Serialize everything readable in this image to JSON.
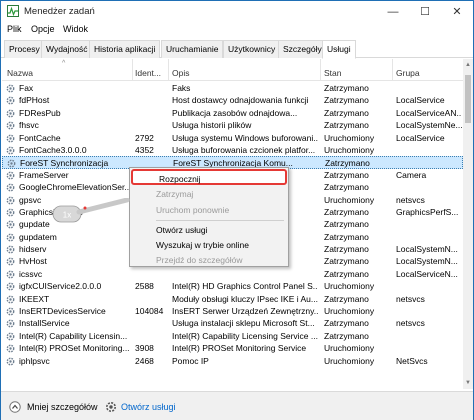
{
  "window": {
    "title": "Menedżer zadań",
    "minimize": "—",
    "maximize": "☐",
    "close": "✕"
  },
  "menubar": [
    "Plik",
    "Opcje",
    "Widok"
  ],
  "tabs": [
    "Procesy",
    "Wydajność",
    "Historia aplikacji",
    "Uruchamianie",
    "Użytkownicy",
    "Szczegóły",
    "Usługi"
  ],
  "active_tab": "Usługi",
  "columns": [
    "Nazwa",
    "Ident...",
    "Opis",
    "Stan",
    "Grupa"
  ],
  "sort_indicator": "^",
  "rows": [
    [
      "Fax",
      "",
      "Faks",
      "Zatrzymano",
      ""
    ],
    [
      "fdPHost",
      "",
      "Host dostawcy odnajdowania funkcji",
      "Zatrzymano",
      "LocalService"
    ],
    [
      "FDResPub",
      "",
      "Publikacja zasobów odnajdowa...",
      "Zatrzymano",
      "LocalServiceAN..."
    ],
    [
      "fhsvc",
      "",
      "Usługa historii plików",
      "Zatrzymano",
      "LocalSystemNe..."
    ],
    [
      "FontCache",
      "2792",
      "Usługa systemu Windows buforowani...",
      "Uruchomiony",
      "LocalService"
    ],
    [
      "FontCache3.0.0.0",
      "4352",
      "Usługa buforowania czcionek platfor...",
      "Uruchomiony",
      ""
    ],
    [
      "ForeST Synchronizacja",
      "",
      "ForeST Synchronizacja Komu...",
      "Zatrzymano",
      ""
    ],
    [
      "FrameServer",
      "",
      "",
      "Zatrzymano",
      "Camera"
    ],
    [
      "GoogleChromeElevationSer...",
      "",
      "",
      "Zatrzymano",
      ""
    ],
    [
      "gpsvc",
      "",
      "",
      "Uruchomiony",
      "netsvcs"
    ],
    [
      "GraphicsPerfSvc",
      "",
      "",
      "Zatrzymano",
      "GraphicsPerfS..."
    ],
    [
      "gupdate",
      "",
      "",
      "Zatrzymano",
      ""
    ],
    [
      "gupdatem",
      "",
      "",
      "Zatrzymano",
      ""
    ],
    [
      "hidserv",
      "",
      "",
      "Zatrzymano",
      "LocalSystemN..."
    ],
    [
      "HvHost",
      "",
      "",
      "Zatrzymano",
      "LocalSystemN..."
    ],
    [
      "icssvc",
      "",
      "",
      "Zatrzymano",
      "LocalServiceN..."
    ],
    [
      "igfxCUIService2.0.0.0",
      "2588",
      "Intel(R) HD Graphics Control Panel S...",
      "Uruchomiony",
      ""
    ],
    [
      "IKEEXT",
      "",
      "Moduły obsługi kluczy IPsec IKE i Au...",
      "Zatrzymano",
      "netsvcs"
    ],
    [
      "InsERTDevicesService",
      "104084",
      "InsERT Serwer Urządzeń Zewnętrzny...",
      "Uruchomiony",
      ""
    ],
    [
      "InstallService",
      "",
      "Usługa instalacji sklepu Microsoft St...",
      "Zatrzymano",
      "netsvcs"
    ],
    [
      "Intel(R) Capability Licensin...",
      "",
      "Intel(R) Capability Licensing Service ...",
      "Zatrzymano",
      ""
    ],
    [
      "Intel(R) PROSet Monitoring...",
      "3908",
      "Intel(R) PROSet Monitoring Service",
      "Uruchomiony",
      ""
    ],
    [
      "iphlpsvc",
      "2468",
      "Pomoc IP",
      "Uruchomiony",
      "NetSvcs"
    ]
  ],
  "selected_row": 6,
  "context_menu": {
    "items": [
      "Rozpocznij",
      "Zatrzymaj",
      "Uruchom ponownie",
      "Otwórz usługi",
      "Wyszukaj w trybie online",
      "Przejdź do szczegółów"
    ],
    "disabled": [
      false,
      true,
      true,
      false,
      false,
      true
    ],
    "highlighted": "Rozpocznij"
  },
  "cursor_hint": "1x",
  "footer": {
    "fewer_details": "Mniej szczegółów",
    "open_services": "Otwórz usługi"
  },
  "colors": {
    "selection": "#cce8ff",
    "highlight_border": "#e53935",
    "link": "#0066cc"
  }
}
